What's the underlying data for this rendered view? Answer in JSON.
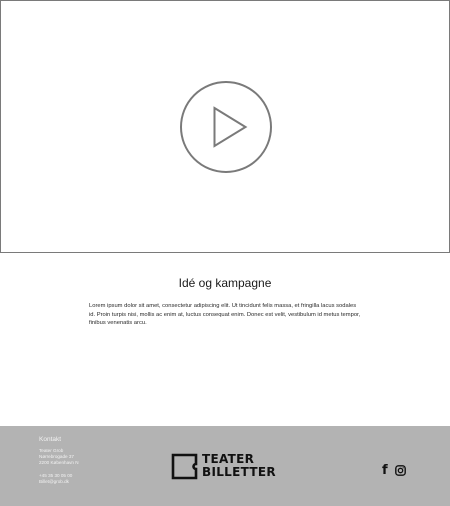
{
  "video": {
    "play_icon": "play-icon"
  },
  "content": {
    "title": "Idé og kampagne",
    "body": "Lorem ipsum dolor sit amet, consectetur adipiscing elit. Ut tincidunt felis massa, et fringilla lacus sodales id. Proin turpis nisi, mollis ac enim at, luctus consequat enim. Donec est velit, vestibulum id metus tempor, finibus venenatis arcu."
  },
  "footer": {
    "contact_heading": "Kontakt",
    "company": "Teater Grob",
    "street": "Nørrebrogade 37",
    "city": "2200 København N",
    "phone": "+45 35 30 05 00",
    "email": "Billet@grob.dk",
    "logo": {
      "line1": "TEATER",
      "line2": "BILLETTER"
    },
    "social": {
      "facebook_glyph": "f",
      "facebook_icon": "facebook-icon",
      "instagram_icon": "instagram-icon"
    }
  },
  "colors": {
    "footer_background": "#b3b3b3",
    "footer_text": "#f2f2f2",
    "border": "#7a7a7a",
    "logo": "#111111"
  }
}
